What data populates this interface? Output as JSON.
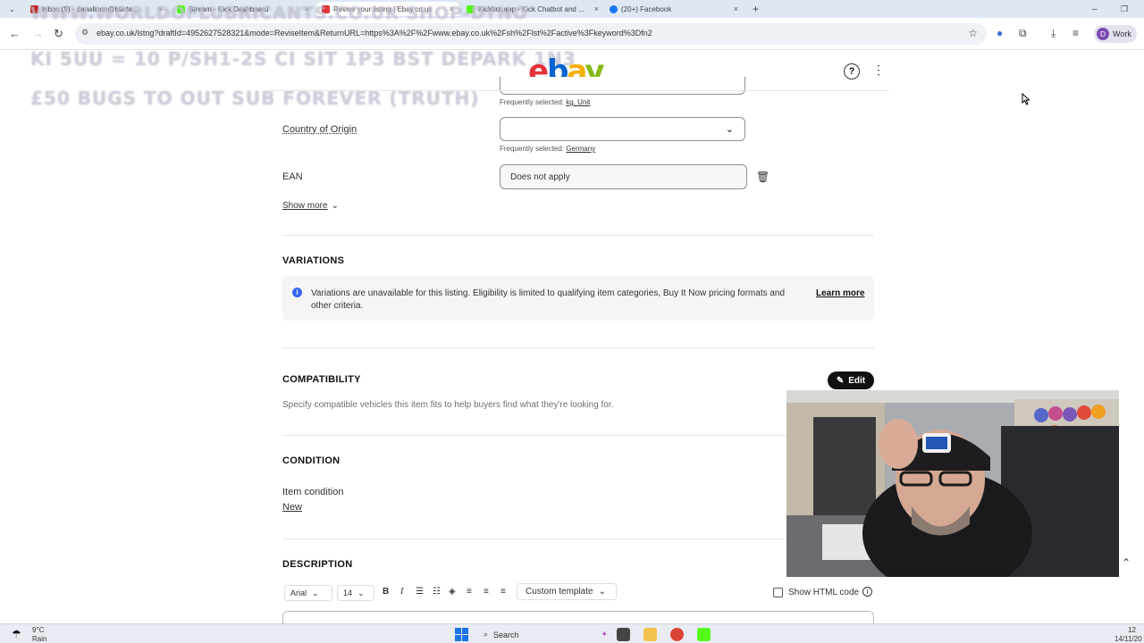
{
  "browser": {
    "tabs": [
      {
        "label": "Inbox (9) - danalinon@btinte...",
        "color": "#c5221f"
      },
      {
        "label": "Stream - Kick Dashboard",
        "color": "#53fc18"
      },
      {
        "label": "Revise your listing | Ebay.co.uk",
        "color": "#e53238"
      },
      {
        "label": "Kickbot.app - Kick Chatbot and ...",
        "color": "#53fc18"
      },
      {
        "label": "(20+) Facebook",
        "color": "#1877f2"
      }
    ],
    "url": "ebay.co.uk/lstng?draftId=4952627528321&mode=ReviseItem&ReturnURL=https%3A%2F%2Fwww.ebay.co.uk%2Fsh%2Flst%2Factive%3Fkeyword%3Dfn2",
    "profile_label": "Work",
    "profile_initial": "D"
  },
  "overlay": {
    "line1": "WWW.WORLDOFLUBRICANTS.CO.UK SHOP-DYNO",
    "line2": "KI 5UU = 10 P/SH1-2S CI SIT 1P3 BST DEPARK 1N3",
    "line3": "£50 BUGS TO OUT SUB FOREVER (TRUTH)"
  },
  "header": {
    "logo_letters": [
      "e",
      "b",
      "a",
      "y"
    ],
    "colors": {
      "e": "#e53238",
      "b": "#0064d2",
      "a": "#f5af02",
      "y": "#86b817"
    }
  },
  "form": {
    "unit_frequently_selected": "Frequently selected:",
    "unit_options": "kg, Unit",
    "country_label": "Country of Origin",
    "country_frequently_selected": "Frequently selected:",
    "country_option": "Germany",
    "ean_label": "EAN",
    "ean_value": "Does not apply",
    "show_more": "Show more"
  },
  "variations": {
    "title": "VARIATIONS",
    "info": "Variations are unavailable for this listing. Eligibility is limited to qualifying item categories, Buy It Now pricing formats and other criteria.",
    "learn_more": "Learn more"
  },
  "compatibility": {
    "title": "COMPATIBILITY",
    "edit": "Edit",
    "description": "Specify compatible vehicles this item fits to help buyers find what they're looking for."
  },
  "condition": {
    "title": "CONDITION",
    "label": "Item condition",
    "value": "New"
  },
  "description": {
    "title": "DESCRIPTION",
    "font": "Arial",
    "size": "14",
    "template": "Custom template",
    "show_html": "Show HTML code"
  },
  "taskbar": {
    "temperature": "9°C",
    "weather": "Rain",
    "search": "Search",
    "time": "12",
    "date": "14/11/20"
  }
}
